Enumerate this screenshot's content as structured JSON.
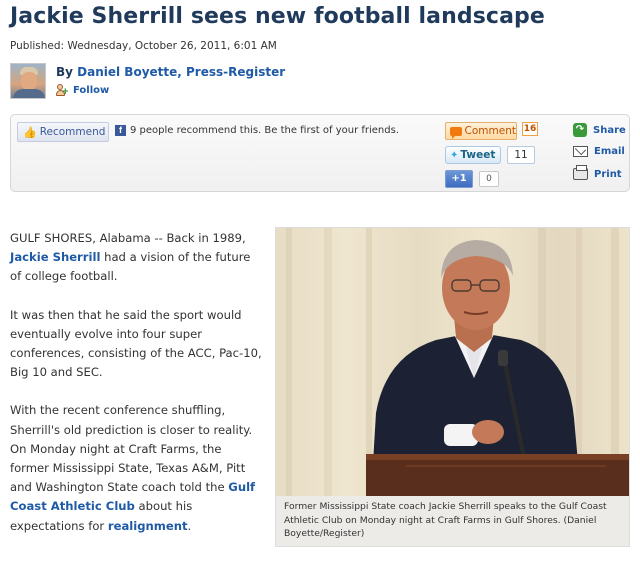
{
  "article": {
    "headline": "Jackie Sherrill sees new football landscape",
    "published": "Published: Wednesday, October 26, 2011, 6:01 AM"
  },
  "author": {
    "by": "By ",
    "name": "Daniel Boyette, Press-Register",
    "follow_label": "Follow"
  },
  "social": {
    "recommend_label": "Recommend",
    "recommend_text": "9 people recommend this. Be the first of your friends.",
    "comment_label": "Comment",
    "comment_count": "16",
    "tweet_label": "Tweet",
    "tweet_count": "11",
    "plusone_label": "+1",
    "plusone_count": "0",
    "share_label": "Share",
    "email_label": "Email",
    "print_label": "Print"
  },
  "body": {
    "p1_a": "GULF SHORES, Alabama -- Back in 1989, ",
    "p1_link": "Jackie Sherrill",
    "p1_b": " had a vision of the future of college football.",
    "p2": "It was then that he said the sport would eventually evolve into four super conferences, consisting of the ACC, Pac-10, Big 10 and SEC.",
    "p3_a": "With the recent conference shuffling, Sherrill's old prediction is closer to reality. On Monday night at Craft Farms, the former Mississippi State, Texas A&M, Pitt and Washington State coach told the ",
    "p3_link1": "Gulf Coast Athletic Club",
    "p3_b": " about his expectations for ",
    "p3_link2": "realignment",
    "p3_c": "."
  },
  "photo": {
    "caption": "Former Mississippi State coach Jackie Sherrill speaks to the Gulf Coast Athletic Club on Monday night at Craft Farms in Gulf Shores. (Daniel Boyette/Register)"
  },
  "colors": {
    "headline": "#1f3a5a",
    "link": "#1f5aa6",
    "facebook": "#3b5998",
    "comment": "#f07a10"
  },
  "icons": [
    "author-photo",
    "follow-icon",
    "thumbs-up-icon",
    "facebook-icon",
    "comment-bubble-icon",
    "twitter-bird-icon",
    "share-icon",
    "email-icon",
    "print-icon"
  ]
}
